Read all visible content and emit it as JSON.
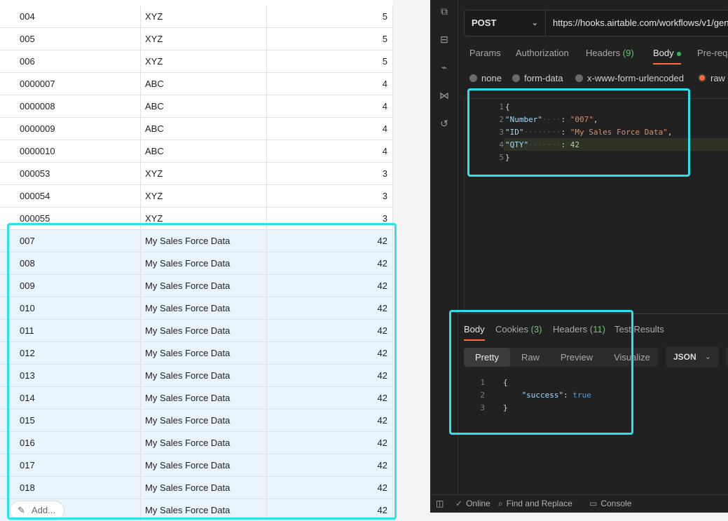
{
  "table": {
    "rows": [
      {
        "number": "004",
        "id": "XYZ",
        "qty": "5"
      },
      {
        "number": "005",
        "id": "XYZ",
        "qty": "5"
      },
      {
        "number": "006",
        "id": "XYZ",
        "qty": "5"
      },
      {
        "number": "0000007",
        "id": "ABC",
        "qty": "4"
      },
      {
        "number": "0000008",
        "id": "ABC",
        "qty": "4"
      },
      {
        "number": "0000009",
        "id": "ABC",
        "qty": "4"
      },
      {
        "number": "0000010",
        "id": "ABC",
        "qty": "4"
      },
      {
        "number": "000053",
        "id": "XYZ",
        "qty": "3"
      },
      {
        "number": "000054",
        "id": "XYZ",
        "qty": "3"
      },
      {
        "number": "000055",
        "id": "XYZ",
        "qty": "3"
      },
      {
        "number": "007",
        "id": "My Sales Force Data",
        "qty": "42"
      },
      {
        "number": "008",
        "id": "My Sales Force Data",
        "qty": "42"
      },
      {
        "number": "009",
        "id": "My Sales Force Data",
        "qty": "42"
      },
      {
        "number": "010",
        "id": "My Sales Force Data",
        "qty": "42"
      },
      {
        "number": "011",
        "id": "My Sales Force Data",
        "qty": "42"
      },
      {
        "number": "012",
        "id": "My Sales Force Data",
        "qty": "42"
      },
      {
        "number": "013",
        "id": "My Sales Force Data",
        "qty": "42"
      },
      {
        "number": "014",
        "id": "My Sales Force Data",
        "qty": "42"
      },
      {
        "number": "015",
        "id": "My Sales Force Data",
        "qty": "42"
      },
      {
        "number": "016",
        "id": "My Sales Force Data",
        "qty": "42"
      },
      {
        "number": "017",
        "id": "My Sales Force Data",
        "qty": "42"
      },
      {
        "number": "018",
        "id": "My Sales Force Data",
        "qty": "42"
      },
      {
        "number": "",
        "id": "My Sales Force Data",
        "qty": "42"
      }
    ],
    "add_label": "Add..."
  },
  "postman": {
    "method": "POST",
    "url": "https://hooks.airtable.com/workflows/v1/gen",
    "request_tabs": {
      "params": "Params",
      "authorization": "Authorization",
      "headers": "Headers",
      "headers_count": "(9)",
      "body": "Body",
      "prerequest": "Pre-req"
    },
    "body_types": {
      "none": "none",
      "form_data": "form-data",
      "urlencoded": "x-www-form-urlencoded",
      "raw": "raw"
    },
    "request_body": {
      "line_numbers": [
        "1",
        "2",
        "3",
        "4",
        "5"
      ],
      "open_brace": "{",
      "close_brace": "}",
      "key_number": "\"Number\"",
      "val_number": "\"007\"",
      "key_id": "\"ID\"",
      "val_id": "\"My Sales Force Data\"",
      "key_qty": "\"QTY\"",
      "val_qty": "42"
    },
    "response_tabs": {
      "body": "Body",
      "cookies": "Cookies",
      "cookies_count": "(3)",
      "headers": "Headers",
      "headers_count": "(11)",
      "test_results": "Test Results"
    },
    "view_modes": {
      "pretty": "Pretty",
      "raw": "Raw",
      "preview": "Preview",
      "visualize": "Visualize"
    },
    "format": "JSON",
    "response_body": {
      "line_numbers": [
        "1",
        "2",
        "3"
      ],
      "open_brace": "{",
      "close_brace": "}",
      "key": "\"success\"",
      "value": "true"
    },
    "status_bar": {
      "online": "Online",
      "find_replace": "Find and Replace",
      "console": "Console"
    }
  },
  "colors": {
    "highlight_border": "#2ee0ea",
    "accent": "#ff6c37",
    "selected_row": "#e9f4fc"
  }
}
